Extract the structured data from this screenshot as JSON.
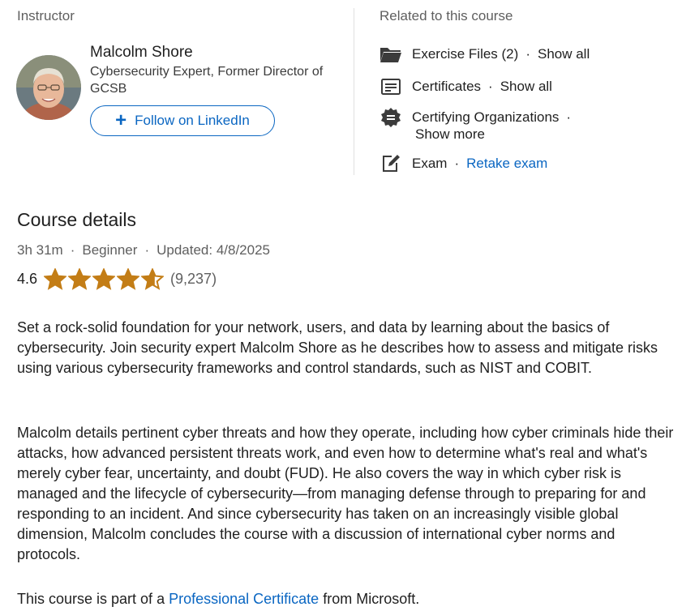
{
  "instructor": {
    "section_label": "Instructor",
    "name": "Malcolm Shore",
    "title": "Cybersecurity Expert, Former Director of GCSB",
    "follow_label": "Follow on LinkedIn"
  },
  "related": {
    "section_label": "Related to this course",
    "items": [
      {
        "icon": "folder-icon",
        "label": "Exercise Files (2)",
        "action": "Show all"
      },
      {
        "icon": "certificate-icon",
        "label": "Certificates",
        "action": "Show all"
      },
      {
        "icon": "badge-seal-icon",
        "label": "Certifying Organizations",
        "action": "Show more"
      },
      {
        "icon": "exam-edit-icon",
        "label": "Exam",
        "action": "Retake exam"
      }
    ]
  },
  "course": {
    "heading": "Course details",
    "duration": "3h 31m",
    "level": "Beginner",
    "updated": "Updated: 4/8/2025",
    "rating_value": "4.6",
    "rating_stars": 4.6,
    "rating_count": "(9,237)",
    "star_color": "#c37d16",
    "description_1": "Set a rock-solid foundation for your network, users, and data by learning about the basics of cybersecurity. Join security expert Malcolm Shore as he describes how to assess and mitigate risks using various cybersecurity frameworks and control standards, such as NIST and COBIT.",
    "description_2": "Malcolm details pertinent cyber threats and how they operate, including how cyber criminals hide their attacks, how advanced persistent threats work, and even how to determine what's real and what's merely cyber fear, uncertainty, and doubt (FUD). He also covers the way in which cyber risk is managed and the lifecycle of cybersecurity—from managing defense through to preparing for and responding to an incident. And since cybersecurity has taken on an increasingly visible global dimension, Malcolm concludes the course with a discussion of international cyber norms and protocols.",
    "part_of_prefix": "This course is part of a",
    "part_of_link": "Professional Certificate",
    "part_of_suffix": "from Microsoft."
  },
  "colors": {
    "link": "#0a66c2",
    "muted": "#5f5f5f",
    "text": "#1f1f1f"
  }
}
